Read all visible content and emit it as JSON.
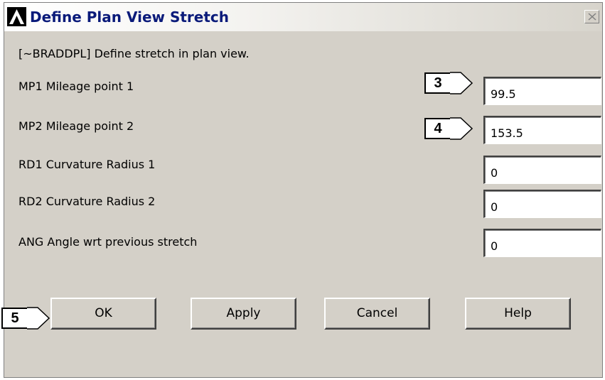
{
  "window": {
    "title": "Define Plan View Stretch",
    "description": "[~BRADDPL] Define stretch in plan view."
  },
  "fields": [
    {
      "label": "MP1 Mileage point 1",
      "value": "99.5"
    },
    {
      "label": "MP2 Mileage point 2",
      "value": "153.5"
    },
    {
      "label": "RD1 Curvature Radius 1",
      "value": "0"
    },
    {
      "label": "RD2 Curvature Radius 2",
      "value": "0"
    },
    {
      "label": "ANG Angle wrt previous stretch",
      "value": "0"
    }
  ],
  "callouts": [
    "3",
    "4",
    "5"
  ],
  "buttons": {
    "ok": "OK",
    "apply": "Apply",
    "cancel": "Cancel",
    "help": "Help"
  },
  "icons": {
    "app_logo": "ansys-logo-icon",
    "close": "close-icon"
  },
  "colors": {
    "dialog_bg": "#d4d0c8",
    "title_text": "#0a1a7a"
  }
}
